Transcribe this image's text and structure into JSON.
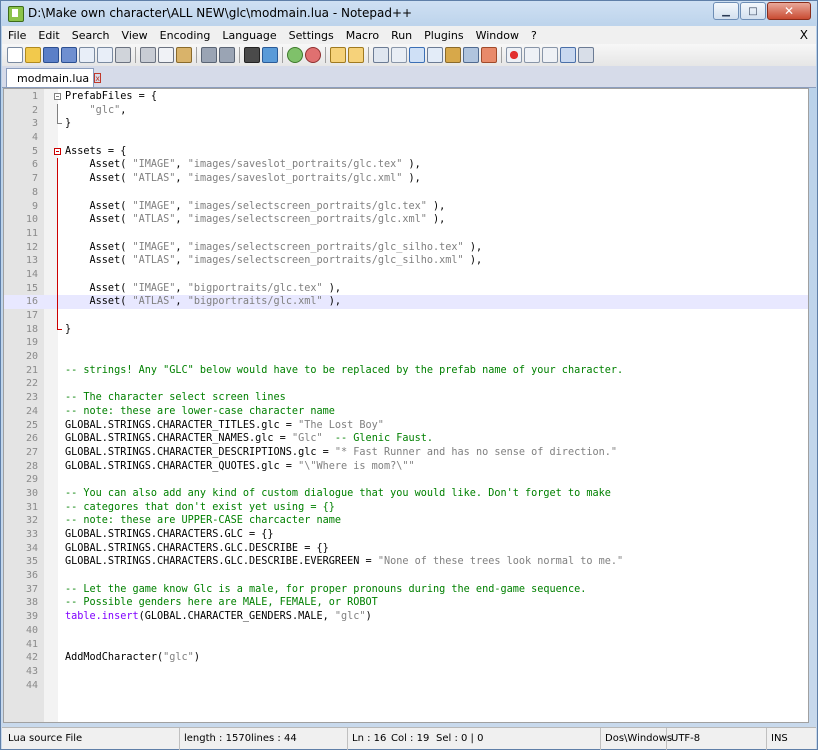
{
  "window": {
    "title": "D:\\Make own character\\ALL NEW\\glc\\modmain.lua - Notepad++",
    "minimize_label": "▁",
    "maximize_label": "□",
    "close_label": "✕"
  },
  "menu": [
    "File",
    "Edit",
    "Search",
    "View",
    "Encoding",
    "Language",
    "Settings",
    "Macro",
    "Run",
    "Plugins",
    "Window",
    "?"
  ],
  "menu_close": "X",
  "toolbar": {
    "icons": [
      "new-file-icon",
      "open-file-icon",
      "save-icon",
      "save-all-icon",
      "close-icon",
      "close-all-icon",
      "print-icon",
      "cut-icon",
      "copy-icon",
      "paste-icon",
      "undo-icon",
      "redo-icon",
      "find-icon",
      "replace-icon",
      "zoom-in-icon",
      "zoom-out-icon",
      "sync-vertical-icon",
      "sync-horizontal-icon",
      "word-wrap-icon",
      "show-all-chars-icon",
      "indent-guide-icon",
      "user-language-icon",
      "doc-map-icon",
      "function-list-icon",
      "record-macro-icon",
      "stop-macro-icon",
      "play-macro-icon",
      "run-macro-multiple-icon",
      "save-macro-icon"
    ]
  },
  "tab": {
    "label": "modmain.lua",
    "close_label": "x"
  },
  "editor": {
    "lines": [
      {
        "n": "1",
        "text": "PrefabFiles = {"
      },
      {
        "n": "2",
        "text": "    \"glc\","
      },
      {
        "n": "3",
        "text": "}"
      },
      {
        "n": "4",
        "text": ""
      },
      {
        "n": "5",
        "text": "Assets = {"
      },
      {
        "n": "6",
        "text": "    Asset( \"IMAGE\", \"images/saveslot_portraits/glc.tex\" ),"
      },
      {
        "n": "7",
        "text": "    Asset( \"ATLAS\", \"images/saveslot_portraits/glc.xml\" ),"
      },
      {
        "n": "8",
        "text": ""
      },
      {
        "n": "9",
        "text": "    Asset( \"IMAGE\", \"images/selectscreen_portraits/glc.tex\" ),"
      },
      {
        "n": "10",
        "text": "    Asset( \"ATLAS\", \"images/selectscreen_portraits/glc.xml\" ),"
      },
      {
        "n": "11",
        "text": ""
      },
      {
        "n": "12",
        "text": "    Asset( \"IMAGE\", \"images/selectscreen_portraits/glc_silho.tex\" ),"
      },
      {
        "n": "13",
        "text": "    Asset( \"ATLAS\", \"images/selectscreen_portraits/glc_silho.xml\" ),"
      },
      {
        "n": "14",
        "text": ""
      },
      {
        "n": "15",
        "text": "    Asset( \"IMAGE\", \"bigportraits/glc.tex\" ),"
      },
      {
        "n": "16",
        "text": "    Asset( \"ATLAS\", \"bigportraits/glc.xml\" ),"
      },
      {
        "n": "17",
        "text": ""
      },
      {
        "n": "18",
        "text": "}"
      },
      {
        "n": "19",
        "text": ""
      },
      {
        "n": "20",
        "text": ""
      },
      {
        "n": "21",
        "text": "-- strings! Any \"GLC\" below would have to be replaced by the prefab name of your character."
      },
      {
        "n": "22",
        "text": ""
      },
      {
        "n": "23",
        "text": "-- The character select screen lines"
      },
      {
        "n": "24",
        "text": "-- note: these are lower-case character name"
      },
      {
        "n": "25",
        "text": "GLOBAL.STRINGS.CHARACTER_TITLES.glc = \"The Lost Boy\""
      },
      {
        "n": "26",
        "text": "GLOBAL.STRINGS.CHARACTER_NAMES.glc = \"Glc\"  -- Glenic Faust."
      },
      {
        "n": "27",
        "text": "GLOBAL.STRINGS.CHARACTER_DESCRIPTIONS.glc = \"* Fast Runner and has no sense of direction.\""
      },
      {
        "n": "28",
        "text": "GLOBAL.STRINGS.CHARACTER_QUOTES.glc = \"\\\"Where is mom?\\\"\""
      },
      {
        "n": "29",
        "text": ""
      },
      {
        "n": "30",
        "text": "-- You can also add any kind of custom dialogue that you would like. Don't forget to make"
      },
      {
        "n": "31",
        "text": "-- categores that don't exist yet using = {}"
      },
      {
        "n": "32",
        "text": "-- note: these are UPPER-CASE charcacter name"
      },
      {
        "n": "33",
        "text": "GLOBAL.STRINGS.CHARACTERS.GLC = {}"
      },
      {
        "n": "34",
        "text": "GLOBAL.STRINGS.CHARACTERS.GLC.DESCRIBE = {}"
      },
      {
        "n": "35",
        "text": "GLOBAL.STRINGS.CHARACTERS.GLC.DESCRIBE.EVERGREEN = \"None of these trees look normal to me.\""
      },
      {
        "n": "36",
        "text": ""
      },
      {
        "n": "37",
        "text": "-- Let the game know Glc is a male, for proper pronouns during the end-game sequence."
      },
      {
        "n": "38",
        "text": "-- Possible genders here are MALE, FEMALE, or ROBOT"
      },
      {
        "n": "39",
        "text": "table.insert(GLOBAL.CHARACTER_GENDERS.MALE, \"glc\")"
      },
      {
        "n": "40",
        "text": ""
      },
      {
        "n": "41",
        "text": ""
      },
      {
        "n": "42",
        "text": "AddModCharacter(\"glc\")"
      },
      {
        "n": "43",
        "text": ""
      },
      {
        "n": "44",
        "text": ""
      }
    ],
    "current_line": 16
  },
  "status": {
    "language": "Lua source File",
    "length": "length : 1570",
    "lines": "lines : 44",
    "ln": "Ln : 16",
    "col": "Col : 19",
    "sel": "Sel : 0 | 0",
    "eol": "Dos\\Windows",
    "encoding": "UTF-8",
    "mode": "INS"
  },
  "colors": {
    "comment": "#008000",
    "string": "#808080",
    "keyword": "#8000ff",
    "current_line": "#e8e8ff",
    "fold_marker": "#c00000"
  }
}
